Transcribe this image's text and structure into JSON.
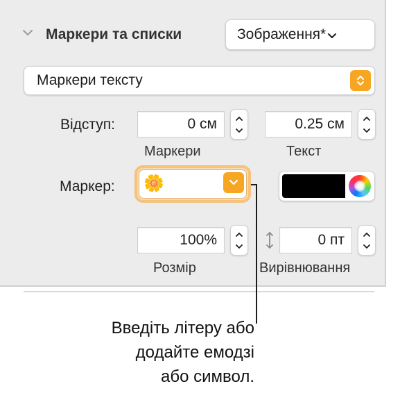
{
  "section": {
    "title": "Маркери та списки",
    "style_popup_label": "Зображення*",
    "list_type": "Маркери тексту"
  },
  "indent": {
    "label": "Відступ:",
    "bullets_value": "0 см",
    "bullets_caption": "Маркери",
    "text_value": "0.25 см",
    "text_caption": "Текст"
  },
  "bullet": {
    "label": "Маркер:",
    "emoji": "🌼",
    "color": "#000000"
  },
  "size": {
    "value": "100%",
    "caption": "Розмір"
  },
  "align": {
    "value": "0 пт",
    "caption": "Вирівнювання"
  },
  "callout": {
    "lines": [
      "Введіть літеру або",
      "додайте емодзі",
      "або символ."
    ]
  },
  "colors": {
    "accent": "#f6a623",
    "focus_ring": "#f7c27a",
    "panel_bg": "#ececec"
  }
}
